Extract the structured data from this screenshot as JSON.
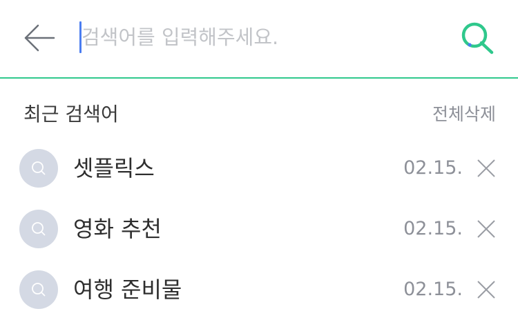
{
  "search": {
    "placeholder": "검색어를 입력해주세요.",
    "value": "",
    "accent_color": "#2fc88c",
    "caret_color": "#4a7df0",
    "back_icon": "arrow-left-icon",
    "submit_icon": "search-icon"
  },
  "recent": {
    "title": "최근 검색어",
    "clear_all_label": "전체삭제",
    "items": [
      {
        "label": "셋플릭스",
        "date": "02.15.",
        "icon": "search-icon",
        "delete_icon": "close-icon"
      },
      {
        "label": "영화 추천",
        "date": "02.15.",
        "icon": "search-icon",
        "delete_icon": "close-icon"
      },
      {
        "label": "여행 준비물",
        "date": "02.15.",
        "icon": "search-icon",
        "delete_icon": "close-icon"
      }
    ]
  }
}
